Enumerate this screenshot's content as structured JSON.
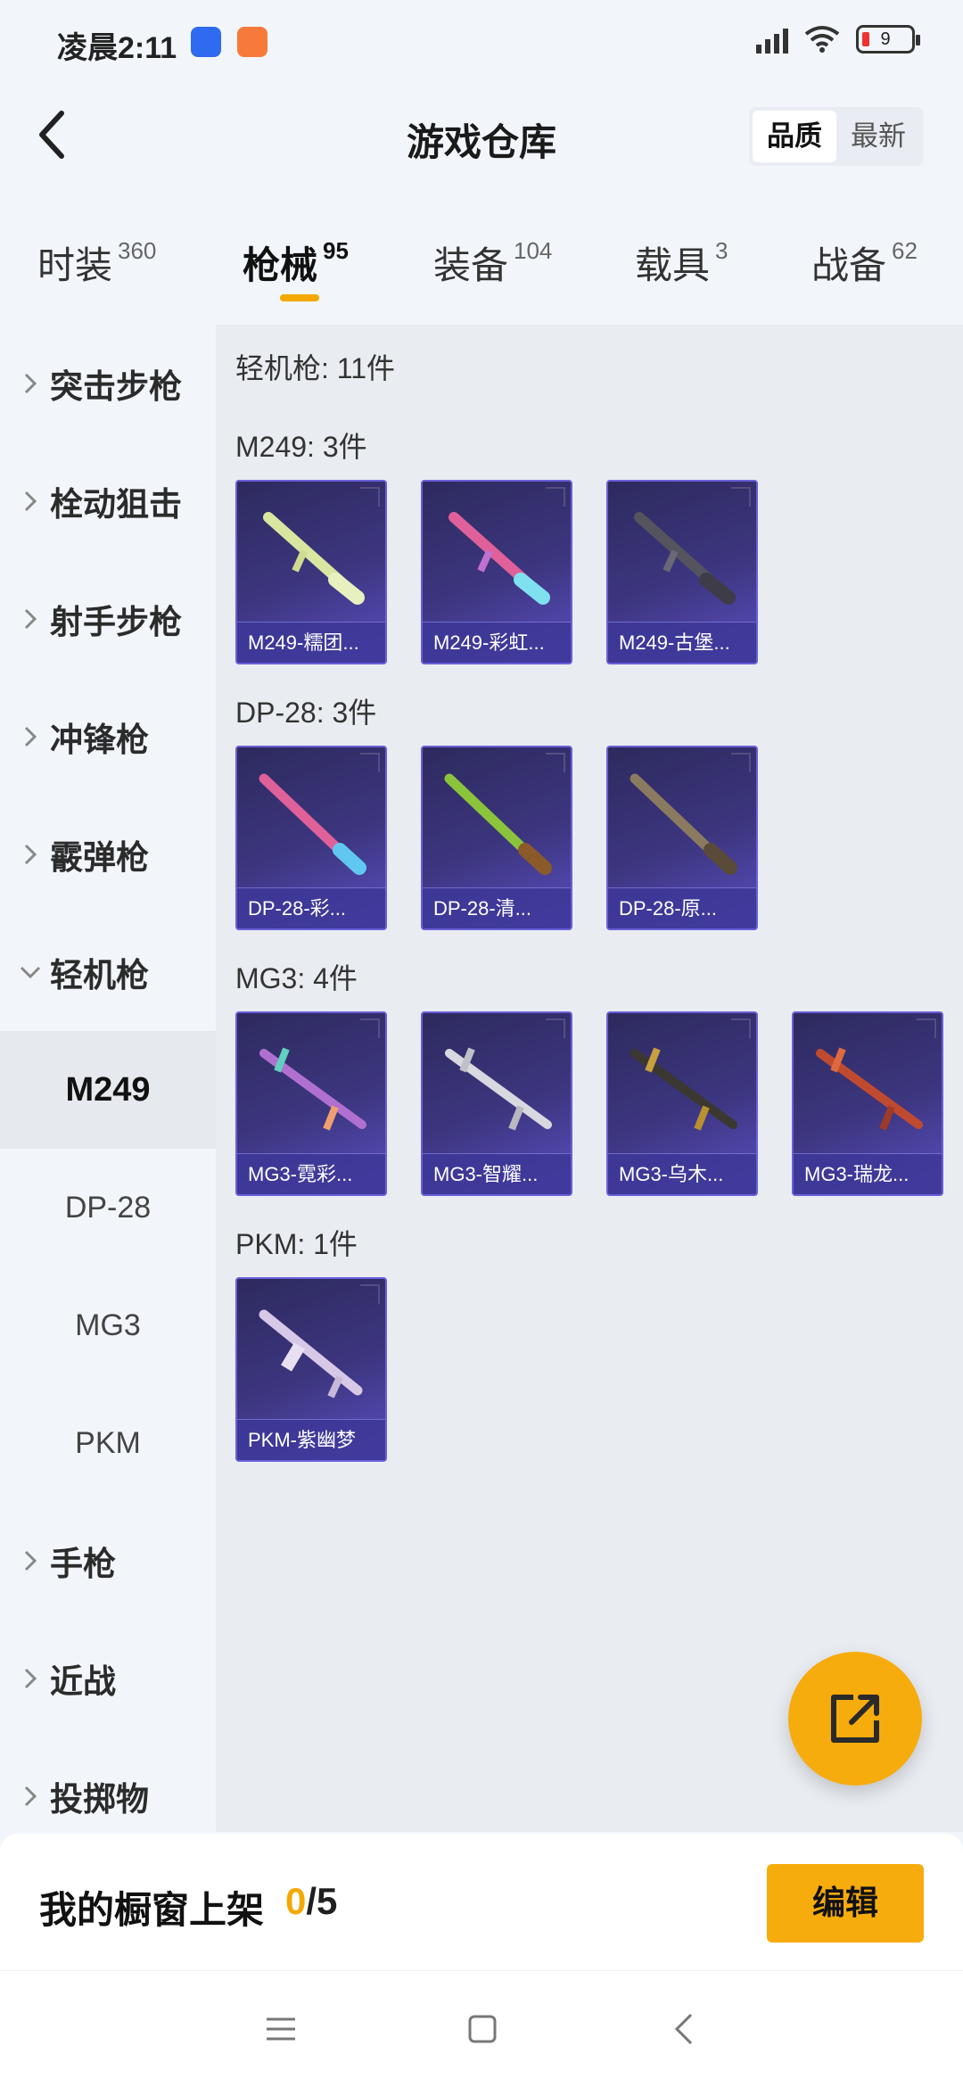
{
  "status_bar": {
    "time": "凌晨2:11",
    "battery": "9"
  },
  "header": {
    "title": "游戏仓库",
    "sort": [
      "品质",
      "最新"
    ],
    "sort_active": 0
  },
  "tabs": [
    {
      "label": "时装",
      "count": "360"
    },
    {
      "label": "枪械",
      "count": "95"
    },
    {
      "label": "装备",
      "count": "104"
    },
    {
      "label": "载具",
      "count": "3"
    },
    {
      "label": "战备",
      "count": "62"
    }
  ],
  "active_tab": 1,
  "sidebar": {
    "categories": [
      {
        "label": "突击步枪"
      },
      {
        "label": "栓动狙击"
      },
      {
        "label": "射手步枪"
      },
      {
        "label": "冲锋枪"
      },
      {
        "label": "霰弹枪"
      },
      {
        "label": "轻机枪"
      },
      {
        "label": "手枪"
      },
      {
        "label": "近战"
      },
      {
        "label": "投掷物"
      }
    ],
    "subitems": [
      "M249",
      "DP-28",
      "MG3",
      "PKM"
    ],
    "active_sub": 0
  },
  "content": {
    "section_title": "轻机枪: 11件",
    "groups": [
      {
        "title": "M249: 3件",
        "items": [
          "M249-糯团...",
          "M249-彩虹...",
          "M249-古堡..."
        ]
      },
      {
        "title": "DP-28: 3件",
        "items": [
          "DP-28-彩...",
          "DP-28-清...",
          "DP-28-原..."
        ]
      },
      {
        "title": "MG3: 4件",
        "items": [
          "MG3-霓彩...",
          "MG3-智耀...",
          "MG3-乌木...",
          "MG3-瑞龙..."
        ]
      },
      {
        "title": "PKM: 1件",
        "items": [
          "PKM-紫幽梦"
        ]
      }
    ]
  },
  "showcase": {
    "label": "我的橱窗上架",
    "current": "0",
    "separator": "/",
    "max": "5",
    "edit_label": "编辑"
  },
  "colors": {
    "accent": "#f7ac0d",
    "card_bg": "#3d3680"
  }
}
